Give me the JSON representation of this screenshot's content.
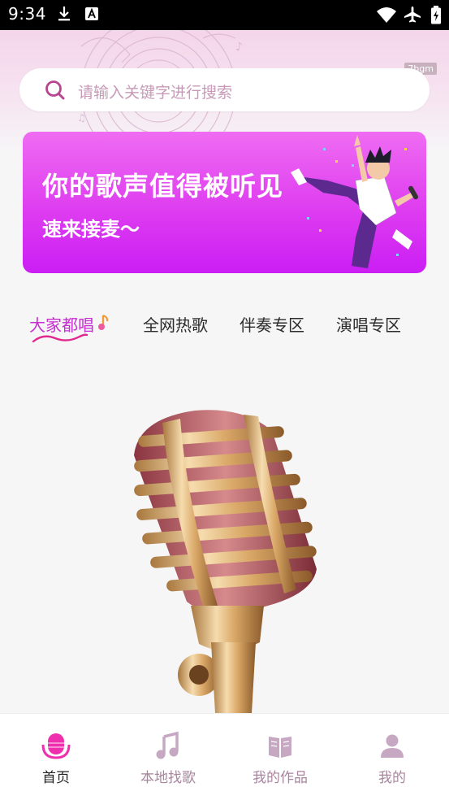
{
  "status_bar": {
    "time": "9:34"
  },
  "watermark": "7bgm",
  "search": {
    "placeholder": "请输入关键字进行搜索",
    "icon": "search-icon"
  },
  "banner": {
    "headline": "你的歌声值得被听见",
    "subline": "速来接麦～"
  },
  "tabs": [
    {
      "label": "大家都唱",
      "active": true
    },
    {
      "label": "全网热歌",
      "active": false
    },
    {
      "label": "伴奏专区",
      "active": false
    },
    {
      "label": "演唱专区",
      "active": false
    }
  ],
  "bottom_nav": [
    {
      "label": "首页",
      "icon": "microphone-icon",
      "active": true
    },
    {
      "label": "本地找歌",
      "icon": "music-note-icon",
      "active": false
    },
    {
      "label": "我的作品",
      "icon": "book-icon",
      "active": false
    },
    {
      "label": "我的",
      "icon": "person-icon",
      "active": false
    }
  ],
  "colors": {
    "accent": "#c72fd0",
    "banner_top": "#ef6cf2",
    "banner_bottom": "#cb1ef4",
    "inactive_nav": "#a8849e"
  }
}
